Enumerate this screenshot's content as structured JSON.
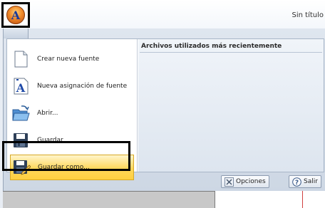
{
  "window": {
    "title": "Sin título"
  },
  "app_button": {
    "glyph": "A"
  },
  "menu": {
    "commands": [
      {
        "label": "Crear nueva fuente",
        "icon": "new-document-icon"
      },
      {
        "label": "Nueva asignación de fuente",
        "icon": "font-assign-icon"
      },
      {
        "label": "Abrir...",
        "icon": "open-folder-icon"
      },
      {
        "label": "Guardar",
        "icon": "save-icon"
      },
      {
        "label": "Guardar como...",
        "icon": "save-as-icon",
        "highlighted": true
      }
    ],
    "recent_title": "Archivos utilizados más recientemente"
  },
  "buttons": {
    "options": {
      "label": "Opciones",
      "icon": "options-icon"
    },
    "exit": {
      "label": "Salir",
      "icon": "help-exit-icon"
    }
  },
  "colors": {
    "highlight": "#ffd75a",
    "menu_bg": "#dfe6ef",
    "app_orange": "#f08a2a"
  }
}
